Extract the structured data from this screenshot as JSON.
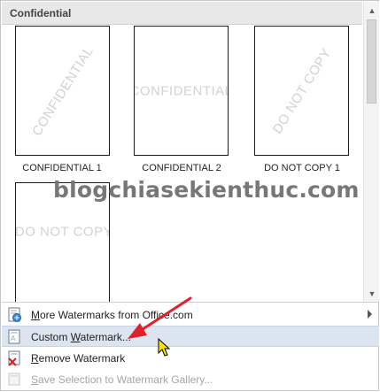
{
  "gallery": {
    "category": "Confidential",
    "items": [
      {
        "watermark": "CONFIDENTIAL",
        "caption": "CONFIDENTIAL 1",
        "style": "diagonal"
      },
      {
        "watermark": "CONFIDENTIAL",
        "caption": "CONFIDENTIAL 2",
        "style": "horizontal"
      },
      {
        "watermark": "DO NOT COPY",
        "caption": "DO NOT COPY 1",
        "style": "diagonal"
      },
      {
        "watermark": "DO NOT COPY",
        "caption": "",
        "style": "horizontal"
      }
    ]
  },
  "overlay_text": "blogchiasekienthuc.com",
  "menu": {
    "items": [
      {
        "label": "More Watermarks from Office.com",
        "underline": "M",
        "icon": "office-watermark-icon",
        "submenu": true,
        "state": "normal"
      },
      {
        "label": "Custom Watermark...",
        "underline": "W",
        "icon": "custom-watermark-icon",
        "submenu": false,
        "state": "hover"
      },
      {
        "label": "Remove Watermark",
        "underline": "R",
        "icon": "remove-watermark-icon",
        "submenu": false,
        "state": "normal"
      },
      {
        "label": "Save Selection to Watermark Gallery...",
        "underline": "S",
        "icon": "save-selection-icon",
        "submenu": false,
        "state": "disabled"
      }
    ]
  },
  "colors": {
    "hover": "#dbe4ef",
    "arrow": "#e0202a",
    "header": "#e8e8e8"
  }
}
